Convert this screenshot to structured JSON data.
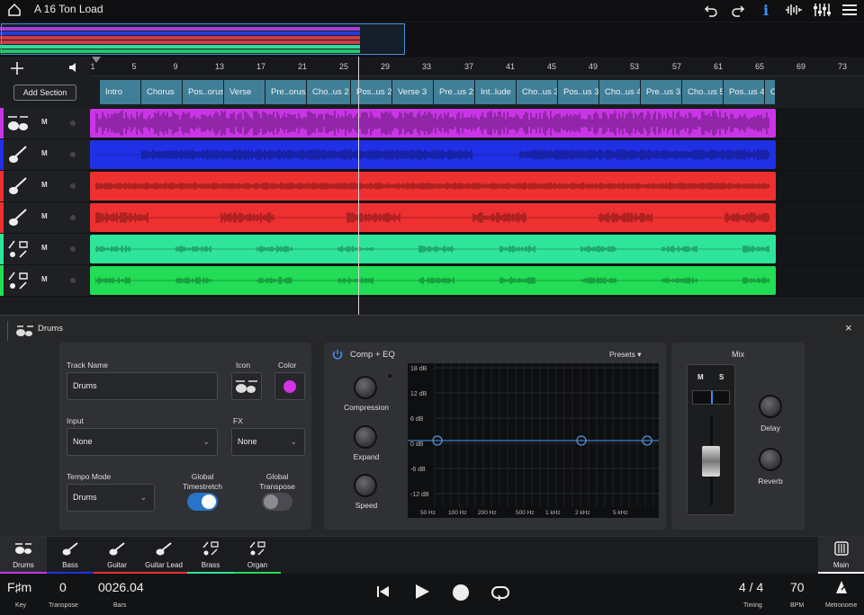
{
  "header": {
    "title": "A 16 Ton Load",
    "icons": [
      "home-icon",
      "undo-icon",
      "redo-icon",
      "info-icon",
      "waveform-icon",
      "mixer-icon",
      "menu-icon"
    ]
  },
  "ruler": {
    "bars": [
      "1",
      "5",
      "9",
      "13",
      "17",
      "21",
      "25",
      "29",
      "33",
      "37",
      "41",
      "45",
      "49",
      "53",
      "57",
      "61",
      "65",
      "69",
      "73"
    ]
  },
  "add_section": "Add Section",
  "sections": [
    "Intro",
    "Chorus",
    "Pos..orus",
    "Verse",
    "Pre..orus",
    "Cho..us 2",
    "Pos..us 2",
    "Verse 3",
    "Pre..us 2",
    "Int..lude",
    "Cho..us 3",
    "Pos..us 3",
    "Cho..us 4",
    "Pre..us 3",
    "Cho..us 5",
    "Pos..us 4",
    "C"
  ],
  "tracks": [
    {
      "name": "Drums",
      "color": "#c935e6",
      "icon": "drums-icon",
      "m": "M"
    },
    {
      "name": "Bass",
      "color": "#2030e6",
      "icon": "guitar-icon",
      "m": "M"
    },
    {
      "name": "Guitar",
      "color": "#ef3030",
      "icon": "guitar-icon",
      "m": "M"
    },
    {
      "name": "Guitar Lead",
      "color": "#ef3030",
      "icon": "guitar-icon",
      "m": "M"
    },
    {
      "name": "Brass",
      "color": "#2fe59a",
      "icon": "multi-instrument-icon",
      "m": "M"
    },
    {
      "name": "Organ",
      "color": "#22dd55",
      "icon": "multi-instrument-icon",
      "m": "M"
    }
  ],
  "panel": {
    "title": "Drums",
    "track_name_label": "Track Name",
    "track_name_value": "Drums",
    "icon_label": "Icon",
    "color_label": "Color",
    "input_label": "Input",
    "input_value": "None",
    "fx_label": "FX",
    "fx_value": "None",
    "tempo_label": "Tempo Mode",
    "tempo_value": "Drums",
    "timestretch_label": "Global Timestretch",
    "transpose_label": "Global Transpose",
    "timestretch_on": true,
    "transpose_on": false,
    "comp_title": "Comp + EQ",
    "presets": "Presets",
    "knobs": [
      "Compression",
      "Expand",
      "Speed"
    ],
    "db_labels": [
      "18 dB",
      "12 dB",
      "6 dB",
      "0 dB",
      "-6 dB",
      "-12 dB"
    ],
    "freq_labels": [
      "50 Hz",
      "100 Hz",
      "200 Hz",
      "500 Hz",
      "1 kHz",
      "2 kHz",
      "5 kHz"
    ],
    "mix_title": "Mix",
    "mute": "M",
    "solo": "S",
    "delay": "Delay",
    "reverb": "Reverb"
  },
  "tabs": [
    "Drums",
    "Bass",
    "Guitar",
    "Guitar Lead",
    "Brass",
    "Organ"
  ],
  "main_tab": "Main",
  "transport": {
    "key": "F♯m",
    "key_label": "Key",
    "transpose": "0",
    "transpose_label": "Transpose",
    "bars": "0026.04",
    "bars_label": "Bars",
    "timing": "4 / 4",
    "timing_label": "Timing",
    "bpm": "70",
    "bpm_label": "BPM",
    "metronome_label": "Metronome"
  }
}
